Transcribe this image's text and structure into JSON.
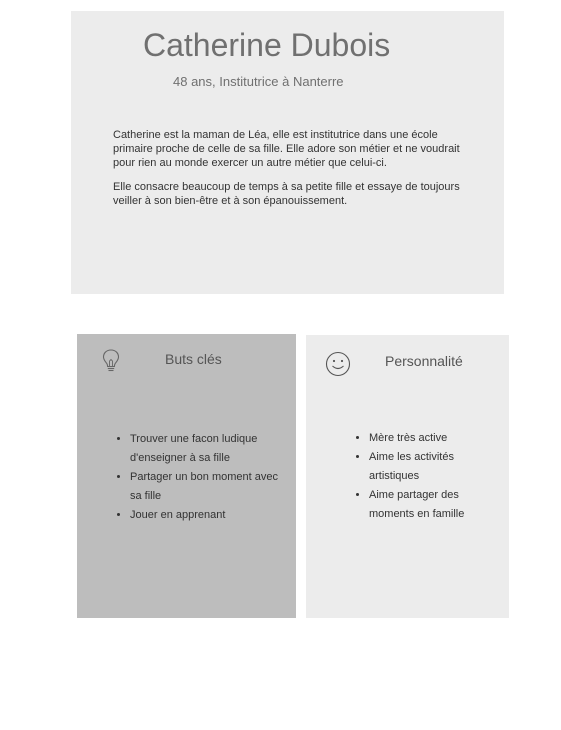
{
  "persona": {
    "name": "Catherine Dubois",
    "subtitle": "48 ans, Institutrice à Nanterre",
    "bio": [
      "Catherine est la maman de Léa, elle est institutrice dans une école primaire proche de celle de sa fille. Elle adore son métier et ne voudrait pour rien au monde exercer un autre métier que celui-ci.",
      "Elle consacre beaucoup de temps à sa petite fille et essaye de toujours veiller à son bien-être et à son épanouissement."
    ]
  },
  "goals": {
    "title": "Buts clés",
    "icon": "lightbulb-icon",
    "items": [
      "Trouver une facon ludique d'enseigner à sa fille",
      "Partager un bon  moment avec sa fille",
      "Jouer en apprenant"
    ]
  },
  "personality": {
    "title": "Personnalité",
    "icon": "smiley-icon",
    "items": [
      "Mère très active",
      "Aime les activités artistiques",
      "Aime partager des moments en famille"
    ]
  },
  "colors": {
    "hero_bg": "#ececec",
    "goals_bg": "#bdbdbd",
    "personality_bg": "#ececec",
    "title_text": "#707070"
  }
}
